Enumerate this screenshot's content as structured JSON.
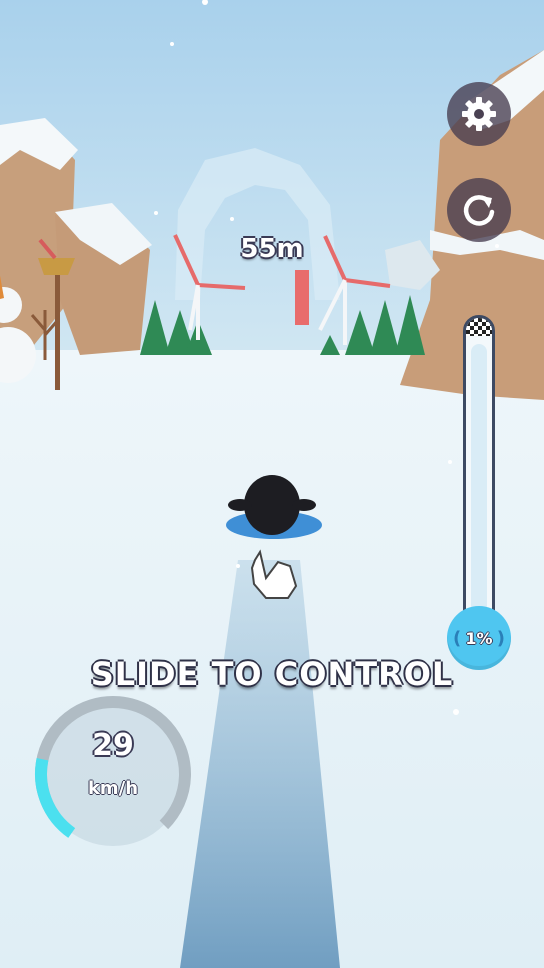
{
  "hud": {
    "distance": "55m",
    "progress_label": "1%",
    "progress_value": 0.01,
    "progress_bracket_left": "(",
    "progress_bracket_right": ")",
    "instruction": "SLIDE TO CONTROL",
    "speed_value": "29",
    "speed_unit": "km/h",
    "speed_fraction": 0.18
  },
  "buttons": {
    "settings_icon": "gear-icon",
    "restart_icon": "restart-icon"
  },
  "colors": {
    "sky": "#b6d8ee",
    "snow": "#e8f3f8",
    "accent_cyan": "#4fc6f0",
    "button_bg": "#4a4152",
    "rock": "#c59b78"
  }
}
